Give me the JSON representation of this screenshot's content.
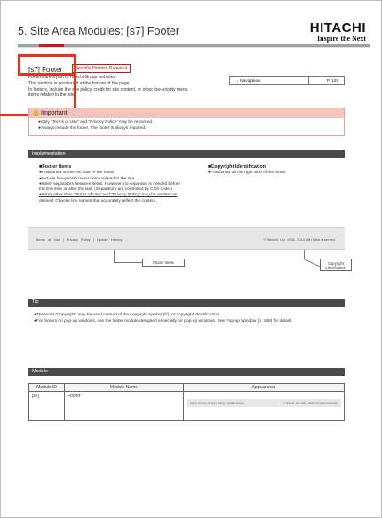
{
  "header": {
    "title": "5. Site Area Modules: [s7] Footer",
    "logo": "HITACHI",
    "tagline": "Inspire the Next"
  },
  "section": {
    "title": "[s7] Footer",
    "badge": "Specific Position Required",
    "intro": [
      "Footers are a part of Hitachi Group websites.",
      "This module is positioned at the bottom of the page.",
      "In footers, include the site policy, credit for site content, or other low-priority menu",
      "items related to the site."
    ]
  },
  "nav": {
    "label": "→ Navigation",
    "page": "P. 128"
  },
  "important": {
    "heading": "Important",
    "items": [
      "●Only \"Terms of Use\" and \"Privacy Policy\" may be reworded.",
      "●Always include the footer. The footer is always required."
    ]
  },
  "implementation": {
    "heading": "Implementation",
    "footer_items": {
      "title": "■Footer Items",
      "lines": [
        "●Positioned on the left side of the footer.",
        "●Include low-priority menu items related to the site.",
        "●Insert separators between items. However, no separator is needed before",
        "  the first item or after the last. (Separators are controlled by CSS code.)"
      ],
      "underlined": [
        "●Items other than \"Terms of Use\" and \"Privacy Policy\" may be omitted as",
        "  desired. Choose link names that accurately reflect the content."
      ]
    },
    "copyright": {
      "title": "■Copyright Identification",
      "lines": [
        "●Positioned on the right side of the footer."
      ]
    },
    "demo": {
      "links": "Terms of Use | Privacy Policy | Update History",
      "copyright": "© Hitachi, Ltd. 1994, 2014. All rights reserved."
    },
    "callouts": {
      "footer_items": "Footer Items",
      "copyright_line1": "Copyright",
      "copyright_line2": "Identification"
    }
  },
  "tip": {
    "heading": "Tip",
    "lines": [
      "●The word \"Copyright\" may be used instead of the copyright symbol (©) for copyright identification.",
      "●For footers on pop-up windows, use the footer module designed especially for pop-up windows. See Pop-up Window (p. 108) for details."
    ]
  },
  "module": {
    "heading": "Module",
    "columns": [
      "Module ID",
      "Module Name",
      "Appearance"
    ],
    "rows": [
      {
        "id": "[s7]",
        "name": "Footer",
        "preview_left": "Terms of Use | Privacy Policy | Update History",
        "preview_right": "© Hitachi, Ltd. 1994, 2014. All rights reserved."
      }
    ]
  }
}
